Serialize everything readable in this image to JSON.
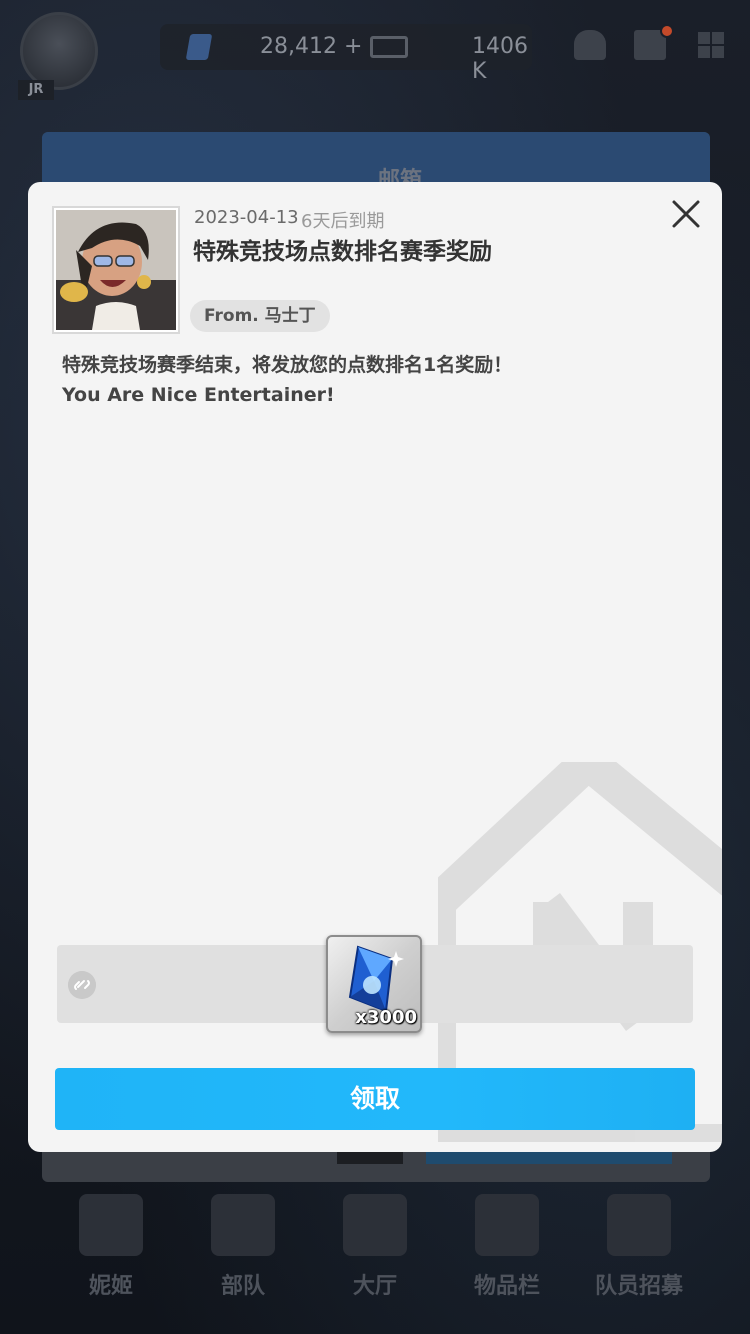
{
  "header": {
    "player_tag": "JR",
    "gems": "28,412",
    "gems_add": "+",
    "credits": "1406 K"
  },
  "background_panel": {
    "title": "邮箱"
  },
  "mail": {
    "date": "2023-04-13",
    "expire_text": "6天后到期",
    "title": "特殊竞技场点数排名赛季奖励",
    "sender": "From. 马士丁",
    "body_line1": "特殊竞技场赛季结束，将发放您的点数排名1名奖励！",
    "body_line2": "You Are Nice Entertainer!",
    "reward": {
      "icon": "blue-crystal-icon",
      "quantity": "x3000"
    },
    "claim_label": "领取"
  },
  "bottom_nav": {
    "items": [
      {
        "label": "妮姬",
        "icon": "nikke-icon"
      },
      {
        "label": "部队",
        "icon": "squad-icon"
      },
      {
        "label": "大厅",
        "icon": "lobby-icon"
      },
      {
        "label": "物品栏",
        "icon": "inventory-icon"
      },
      {
        "label": "队员招募",
        "icon": "recruit-icon"
      }
    ]
  },
  "colors": {
    "accent": "#1fb4f7",
    "popup_bg": "#f4f4f4",
    "text_dark": "#333333"
  }
}
